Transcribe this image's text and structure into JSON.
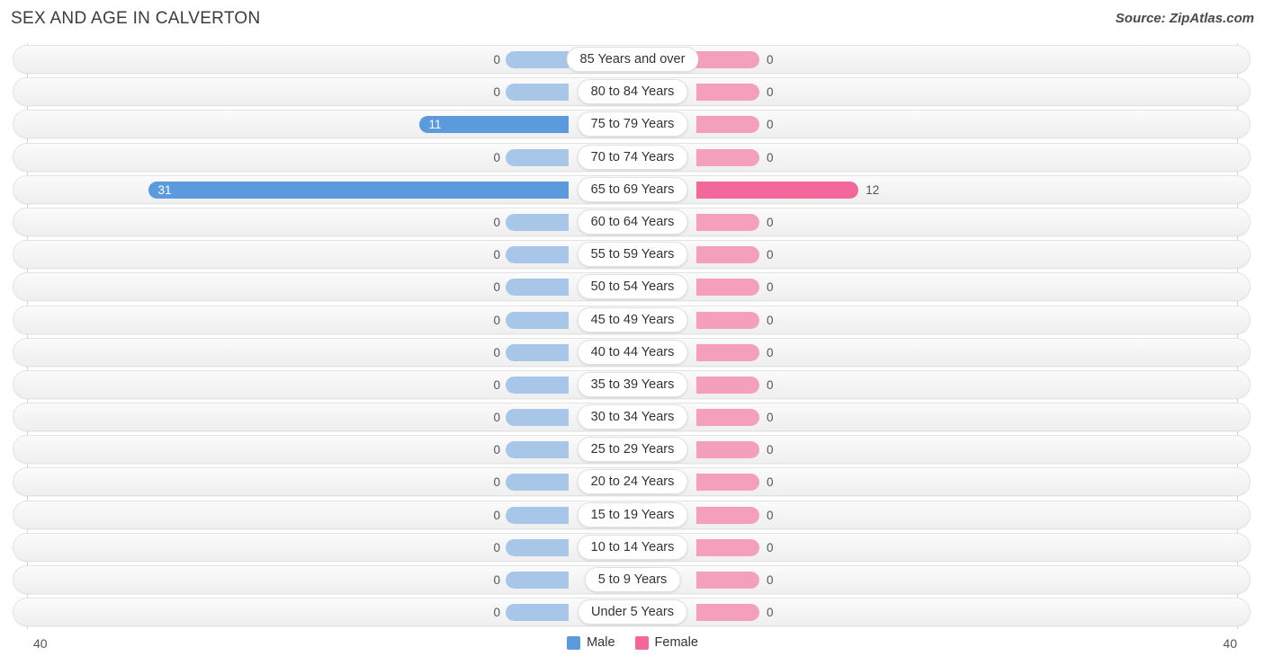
{
  "header": {
    "title": "SEX AND AGE IN CALVERTON",
    "source": "Source: ZipAtlas.com"
  },
  "legend": {
    "male_label": "Male",
    "female_label": "Female",
    "male_color": "#5b9bdd",
    "female_color": "#f2689a",
    "male_color_muted": "#a8c7e8",
    "female_color_muted": "#f4a0bd"
  },
  "axis": {
    "left_tick": "40",
    "right_tick": "40",
    "max": 40
  },
  "chart_data": {
    "type": "bar",
    "title": "SEX AND AGE IN CALVERTON",
    "subtitle": "Source: ZipAtlas.com",
    "xlabel": "",
    "ylabel": "",
    "grid": false,
    "legend_position": "bottom",
    "xlim": [
      40,
      40
    ],
    "series": [
      {
        "name": "Male",
        "color": "#5b9bdd",
        "values": [
          0,
          0,
          11,
          0,
          31,
          0,
          0,
          0,
          0,
          0,
          0,
          0,
          0,
          0,
          0,
          0,
          0,
          0
        ]
      },
      {
        "name": "Female",
        "color": "#f2689a",
        "values": [
          0,
          0,
          0,
          0,
          12,
          0,
          0,
          0,
          0,
          0,
          0,
          0,
          0,
          0,
          0,
          0,
          0,
          0
        ]
      }
    ],
    "categories": [
      "85 Years and over",
      "80 to 84 Years",
      "75 to 79 Years",
      "70 to 74 Years",
      "65 to 69 Years",
      "60 to 64 Years",
      "55 to 59 Years",
      "50 to 54 Years",
      "45 to 49 Years",
      "40 to 44 Years",
      "35 to 39 Years",
      "30 to 34 Years",
      "25 to 29 Years",
      "20 to 24 Years",
      "15 to 19 Years",
      "10 to 14 Years",
      "5 to 9 Years",
      "Under 5 Years"
    ],
    "rows": [
      {
        "label": "85 Years and over",
        "male": "0",
        "female": "0"
      },
      {
        "label": "80 to 84 Years",
        "male": "0",
        "female": "0"
      },
      {
        "label": "75 to 79 Years",
        "male": "11",
        "female": "0"
      },
      {
        "label": "70 to 74 Years",
        "male": "0",
        "female": "0"
      },
      {
        "label": "65 to 69 Years",
        "male": "31",
        "female": "12"
      },
      {
        "label": "60 to 64 Years",
        "male": "0",
        "female": "0"
      },
      {
        "label": "55 to 59 Years",
        "male": "0",
        "female": "0"
      },
      {
        "label": "50 to 54 Years",
        "male": "0",
        "female": "0"
      },
      {
        "label": "45 to 49 Years",
        "male": "0",
        "female": "0"
      },
      {
        "label": "40 to 44 Years",
        "male": "0",
        "female": "0"
      },
      {
        "label": "35 to 39 Years",
        "male": "0",
        "female": "0"
      },
      {
        "label": "30 to 34 Years",
        "male": "0",
        "female": "0"
      },
      {
        "label": "25 to 29 Years",
        "male": "0",
        "female": "0"
      },
      {
        "label": "20 to 24 Years",
        "male": "0",
        "female": "0"
      },
      {
        "label": "15 to 19 Years",
        "male": "0",
        "female": "0"
      },
      {
        "label": "10 to 14 Years",
        "male": "0",
        "female": "0"
      },
      {
        "label": "5 to 9 Years",
        "male": "0",
        "female": "0"
      },
      {
        "label": "Under 5 Years",
        "male": "0",
        "female": "0"
      }
    ]
  }
}
